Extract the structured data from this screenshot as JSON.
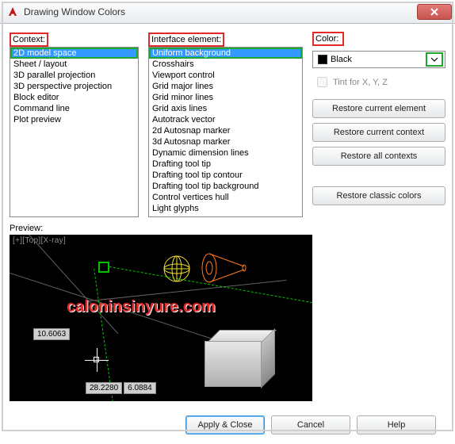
{
  "window": {
    "title": "Drawing Window Colors"
  },
  "labels": {
    "context": "Context:",
    "interface": "Interface element:",
    "color": "Color:",
    "preview": "Preview:",
    "tint": "Tint for X, Y, Z"
  },
  "context": {
    "selected_index": 0,
    "items": [
      "2D model space",
      "Sheet / layout",
      "3D parallel projection",
      "3D perspective projection",
      "Block editor",
      "Command line",
      "Plot preview"
    ]
  },
  "interface": {
    "selected_index": 0,
    "items": [
      "Uniform background",
      "Crosshairs",
      "Viewport control",
      "Grid major lines",
      "Grid minor lines",
      "Grid axis lines",
      "Autotrack vector",
      "2d Autosnap marker",
      "3d Autosnap marker",
      "Dynamic dimension lines",
      "Drafting tool tip",
      "Drafting tool tip contour",
      "Drafting tool tip background",
      "Control vertices hull",
      "Light glyphs"
    ]
  },
  "color": {
    "selected": "Black",
    "hex": "#000000"
  },
  "buttons": {
    "restore_element": "Restore current element",
    "restore_context": "Restore current context",
    "restore_all": "Restore all contexts",
    "restore_classic": "Restore classic colors",
    "apply_close": "Apply & Close",
    "cancel": "Cancel",
    "help": "Help"
  },
  "preview": {
    "corner": "[+][Top][X-ray]",
    "coord1": "10.6063",
    "coord2a": "28.2280",
    "coord2b": "6.0884",
    "watermark": "caloninsinyure.com"
  }
}
